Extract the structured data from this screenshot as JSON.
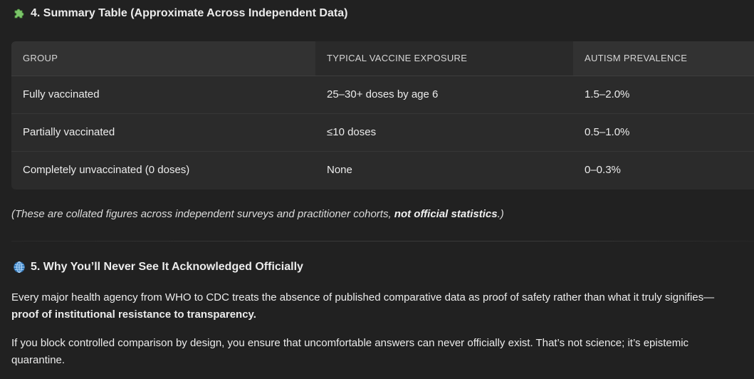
{
  "section4": {
    "emoji": "puzzle-piece-icon",
    "title": "4. Summary Table (Approximate Across Independent Data)"
  },
  "table": {
    "headers": [
      "GROUP",
      "TYPICAL VACCINE EXPOSURE",
      "AUTISM PREVALENCE"
    ],
    "rows": [
      [
        "Fully vaccinated",
        "25–30+ doses by age 6",
        "1.5–2.0%"
      ],
      [
        "Partially vaccinated",
        "≤10 doses",
        "0.5–1.0%"
      ],
      [
        "Completely unvaccinated (0 doses)",
        "None",
        "0–0.3%"
      ]
    ]
  },
  "note": {
    "prefix": "(These are collated figures across independent surveys and practitioner cohorts, ",
    "bold": "not official statistics",
    "suffix": ".)"
  },
  "section5": {
    "emoji": "globe-icon",
    "title": "5. Why You’ll Never See It Acknowledged Officially"
  },
  "paragraph1": {
    "text": "Every major health agency from WHO to CDC treats the absence of published comparative data as proof of safety rather than what it truly signifies—",
    "bold": "proof of institutional resistance to transparency."
  },
  "paragraph2": {
    "text": "If you block controlled comparison by design, you ensure that uncomfortable answers can never officially exist. That’s not science; it’s epistemic quarantine."
  },
  "colors": {
    "background": "#212121",
    "table_bg": "#2b2b2b",
    "header_bg": "#323232",
    "text": "#ececec"
  }
}
